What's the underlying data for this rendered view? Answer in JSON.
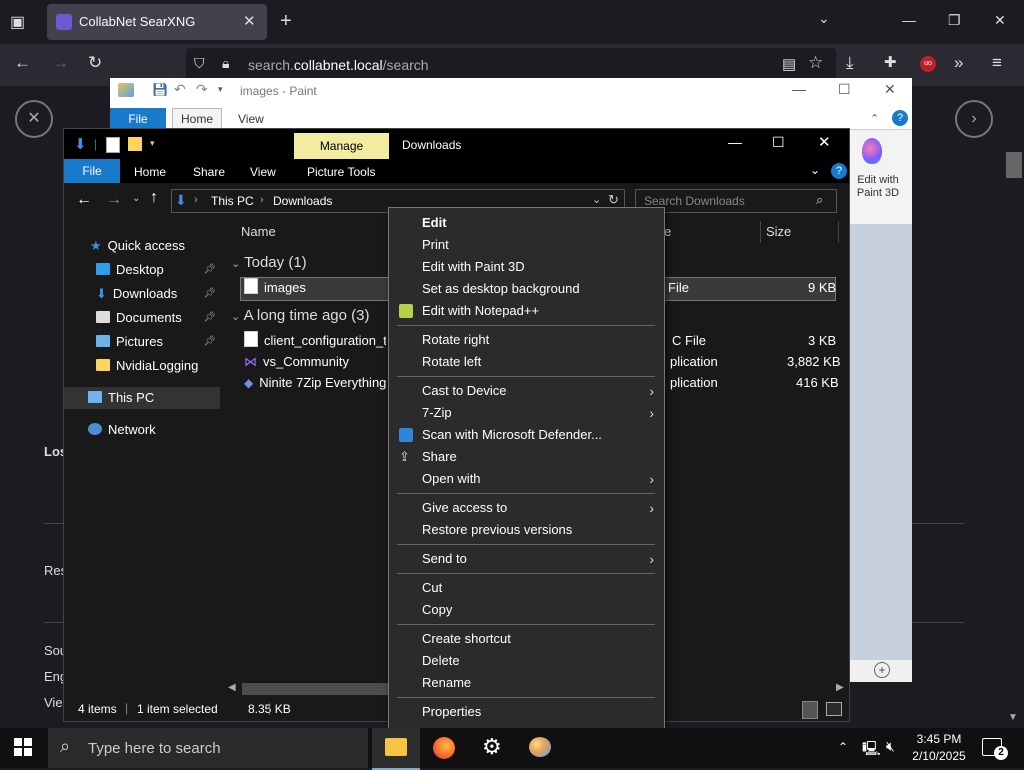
{
  "firefox": {
    "tab_title": "CollabNet SearXNG",
    "url_host": "search.",
    "url_domain": "collabnet.local",
    "url_path": "/search"
  },
  "page_behind": {
    "frag_lost": "Los",
    "frag_res": "Res",
    "frag_sou": "Sou",
    "frag_eng": "Eng",
    "frag_vie": "Vie"
  },
  "paint": {
    "title": "images - Paint",
    "tabs": {
      "file": "File",
      "home": "Home",
      "view": "View"
    },
    "edit_paint3d": "Edit with Paint 3D"
  },
  "explorer": {
    "manage": "Manage",
    "title": "Downloads",
    "tabs": {
      "file": "File",
      "home": "Home",
      "share": "Share",
      "view": "View",
      "picture_tools": "Picture Tools"
    },
    "breadcrumb": [
      "This PC",
      "Downloads"
    ],
    "search_placeholder": "Search Downloads",
    "nav": {
      "quick_access": "Quick access",
      "desktop": "Desktop",
      "downloads": "Downloads",
      "documents": "Documents",
      "pictures": "Pictures",
      "nvidia": "NvidiaLogging",
      "this_pc": "This PC",
      "network": "Network"
    },
    "columns": {
      "name": "Name",
      "type_frag": "e",
      "size": "Size"
    },
    "groups": {
      "today": "Today (1)",
      "long_ago": "A long time ago (3)"
    },
    "files": [
      {
        "name": "images",
        "type": "File",
        "size": "9 KB"
      },
      {
        "name": "client_configuration_tok",
        "type": "C File",
        "size": "3 KB"
      },
      {
        "name": "vs_Community",
        "type": "plication",
        "size": "3,882 KB"
      },
      {
        "name": "Ninite 7Zip Everything F",
        "type": "plication",
        "size": "416 KB"
      }
    ],
    "status": {
      "items": "4 items",
      "selected": "1 item selected",
      "size": "8.35 KB"
    }
  },
  "context_menu": {
    "edit": "Edit",
    "print": "Print",
    "edit_paint3d": "Edit with Paint 3D",
    "desktop_bg": "Set as desktop background",
    "notepad": "Edit with Notepad++",
    "rotate_right": "Rotate right",
    "rotate_left": "Rotate left",
    "cast": "Cast to Device",
    "zip": "7-Zip",
    "defender": "Scan with Microsoft Defender...",
    "share": "Share",
    "open_with": "Open with",
    "give_access": "Give access to",
    "restore": "Restore previous versions",
    "send_to": "Send to",
    "cut": "Cut",
    "copy": "Copy",
    "shortcut": "Create shortcut",
    "delete": "Delete",
    "rename": "Rename",
    "properties": "Properties"
  },
  "taskbar": {
    "search_placeholder": "Type here to search",
    "time": "3:45 PM",
    "date": "2/10/2025",
    "notifications": "2"
  },
  "colors": {
    "accent": "#1979ca",
    "manage": "#f3eb9f",
    "menu_bg": "#2b2b2b"
  }
}
